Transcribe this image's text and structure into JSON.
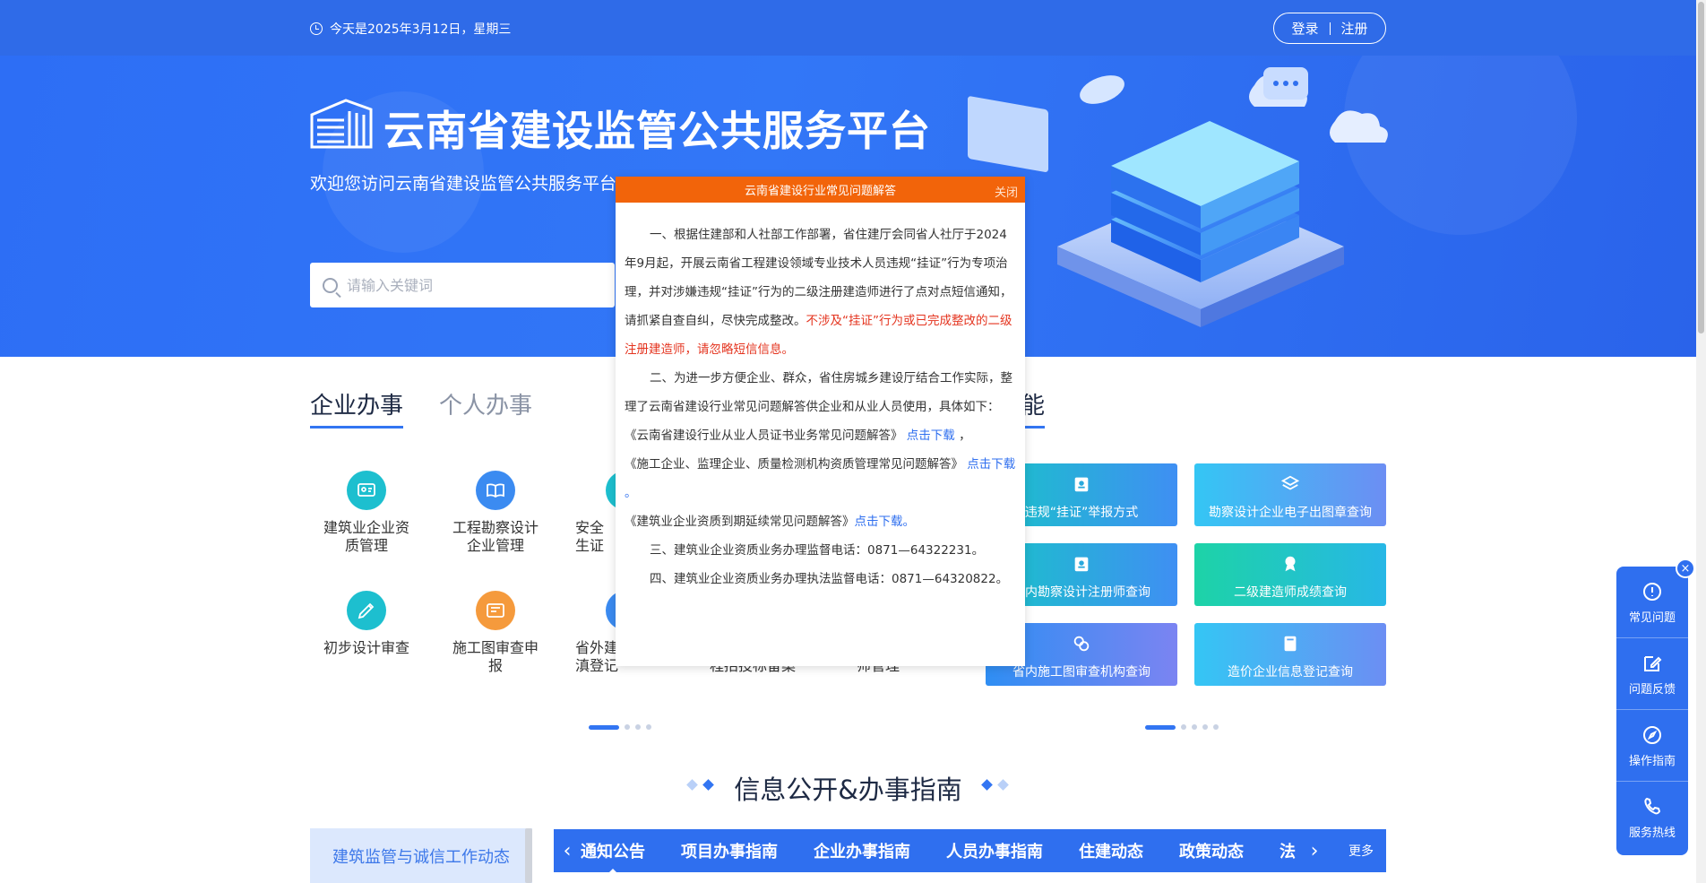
{
  "header": {
    "date_text": "今天是2025年3月12日，星期三",
    "login_label": "登录",
    "register_label": "注册",
    "site_title": "云南省建设监管公共服务平台",
    "welcome": "欢迎您访问云南省建设监管公共服务平台",
    "search_placeholder": "请输入关键词"
  },
  "tabs": {
    "enterprise": "企业办事",
    "personal": "个人办事",
    "right_partial": "能"
  },
  "services": [
    {
      "label": "建筑业企业资质管理",
      "icon": "certificate-icon",
      "color": "#1dbfcf"
    },
    {
      "label": "工程勘察设计企业管理",
      "icon": "book-icon",
      "color": "#3b8bf1"
    },
    {
      "label": "安全生证",
      "icon": "shield-icon",
      "color": "#1dbfcf"
    },
    {
      "label": "初步设计审查",
      "icon": "pencil-icon",
      "color": "#1dbfcf"
    },
    {
      "label": "施工图审查申报",
      "icon": "blueprint-icon",
      "color": "#f59a3c"
    },
    {
      "label": "省外建企业入滇登记",
      "icon": "building-icon",
      "color": "#3b8bf1"
    },
    {
      "label": "程招投标备案",
      "icon": "doc-icon",
      "color": "#3b8bf1"
    },
    {
      "label": "师管理",
      "icon": "user-icon",
      "color": "#3b8bf1"
    }
  ],
  "cards": [
    {
      "label": "违规“挂证”举报方式",
      "icon": "badge-icon"
    },
    {
      "label": "勘察设计企业电子出图章查询",
      "icon": "layers-icon"
    },
    {
      "label": "省内勘察设计注册师查询",
      "icon": "badge-icon"
    },
    {
      "label": "二级建造师成绩查询",
      "icon": "medal-icon"
    },
    {
      "label": "省内施工图审查机构查询",
      "icon": "chain-icon"
    },
    {
      "label": "造价企业信息登记查询",
      "icon": "book-icon"
    }
  ],
  "section": {
    "title": "信息公开&办事指南",
    "left_panel": "建筑监管与诚信工作动态",
    "news_tabs": [
      "通知公告",
      "项目办事指南",
      "企业办事指南",
      "人员办事指南",
      "住建动态",
      "政策动态",
      "法"
    ],
    "more": "更多"
  },
  "side_float": {
    "items": [
      "常见问题",
      "问题反馈",
      "操作指南",
      "服务热线"
    ],
    "close": "×"
  },
  "modal": {
    "title": "云南省建设行业常见问题解答",
    "close": "关闭",
    "p1a": "一、根据住建部和人社部工作部署，省住建厅会同省人社厅于2024年9月起，开展云南省工程建设领域专业技术人员违规“挂证”行为专项治理，并对涉嫌违规“挂证”行为的二级注册建造师进行了点对点短信通知，请抓紧自查自纠，尽快完成整改。",
    "p1b": "不涉及“挂证”行为或已完成整改的二级注册建造师，请忽略短信信息。",
    "p2": "二、为进一步方便企业、群众，省住房城乡建设厅结合工作实际，整理了云南省建设行业常见问题解答供企业和从业人员使用，具体如下：",
    "doc1": "《云南省建设行业从业人员证书业务常见问题解答》",
    "doc1_link": "点击下载",
    "doc1_tail": "，",
    "doc2": "《施工企业、监理企业、质量检测机构资质管理常见问题解答》",
    "doc2_link": "点击下载",
    "doc2_tail": "。",
    "doc3": "《建筑业企业资质到期延续常见问题解答》",
    "doc3_link": "点击下载",
    "doc3_tail": "。",
    "p3": "三、建筑业企业资质业务办理监督电话：0871—64322231。",
    "p4": "四、建筑业企业资质业务办理执法监督电话：0871—64320822。"
  },
  "colors": {
    "primary": "#2f6fef",
    "modal_header": "#f2640a",
    "warning_text": "#e4341f"
  }
}
